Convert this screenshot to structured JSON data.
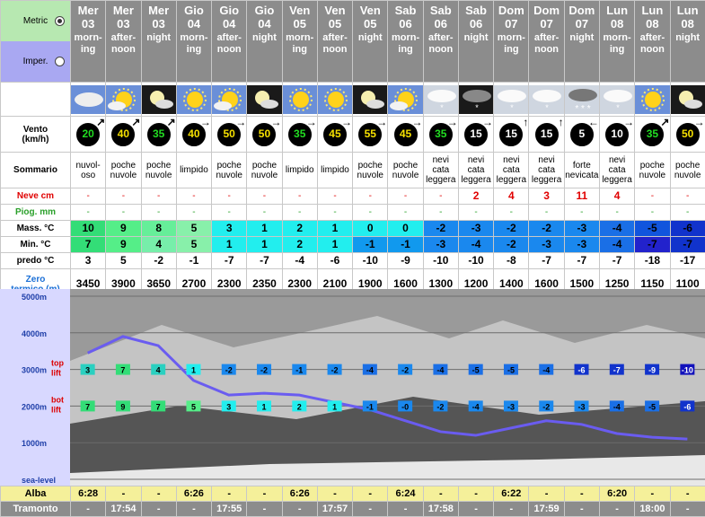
{
  "units": {
    "metric_label": "Metric",
    "imperial_label": "Imper."
  },
  "columns": [
    {
      "day": "Mer",
      "date": "03",
      "period": "morn-\ning",
      "wind_dir": "↗",
      "wind": "20",
      "wind_color": "#22dd22",
      "summary": "nuvol-\noso",
      "snow": "-",
      "rain": "-",
      "max": "10",
      "max_color": "#33dd77",
      "min": "7",
      "min_color": "#33dd77",
      "freeze": "3",
      "zero": "3450",
      "icon": "partly-cloudy"
    },
    {
      "day": "Mer",
      "date": "03",
      "period": "after-\nnoon",
      "wind_dir": "↗",
      "wind": "40",
      "wind_color": "#f5e000",
      "summary": "poche\nnuvole",
      "snow": "-",
      "rain": "-",
      "max": "9",
      "max_color": "#55ee88",
      "min": "9",
      "min_color": "#55ee88",
      "freeze": "5",
      "zero": "3900",
      "icon": "sun-cloud"
    },
    {
      "day": "Mer",
      "date": "03",
      "period": "night",
      "wind_dir": "↗",
      "wind": "35",
      "wind_color": "#22dd22",
      "summary": "poche\nnuvole",
      "snow": "-",
      "rain": "-",
      "max": "8",
      "max_color": "#66ee99",
      "min": "4",
      "min_color": "#77eeaa",
      "freeze": "-2",
      "zero": "3650",
      "icon": "moon-cloud"
    },
    {
      "day": "Gio",
      "date": "04",
      "period": "morn-\ning",
      "wind_dir": "→",
      "wind": "40",
      "wind_color": "#f5e000",
      "summary": "limpido",
      "snow": "-",
      "rain": "-",
      "max": "5",
      "max_color": "#88f0aa",
      "min": "5",
      "min_color": "#88f0aa",
      "freeze": "-1",
      "zero": "2700",
      "icon": "sun"
    },
    {
      "day": "Gio",
      "date": "04",
      "period": "after-\nnoon",
      "wind_dir": "→",
      "wind": "50",
      "wind_color": "#f5e000",
      "summary": "poche\nnuvole",
      "snow": "-",
      "rain": "-",
      "max": "3",
      "max_color": "#22eeee",
      "min": "1",
      "min_color": "#22eeee",
      "freeze": "-7",
      "zero": "2300",
      "icon": "sun-cloud"
    },
    {
      "day": "Gio",
      "date": "04",
      "period": "night",
      "wind_dir": "→",
      "wind": "50",
      "wind_color": "#f5e000",
      "summary": "poche\nnuvole",
      "snow": "-",
      "rain": "-",
      "max": "1",
      "max_color": "#22eeee",
      "min": "1",
      "min_color": "#22eeee",
      "freeze": "-7",
      "zero": "2350",
      "icon": "moon-cloud"
    },
    {
      "day": "Ven",
      "date": "05",
      "period": "morn-\ning",
      "wind_dir": "→",
      "wind": "35",
      "wind_color": "#22dd22",
      "summary": "limpido",
      "snow": "-",
      "rain": "-",
      "max": "2",
      "max_color": "#22eeee",
      "min": "2",
      "min_color": "#22eeee",
      "freeze": "-4",
      "zero": "2300",
      "icon": "sun"
    },
    {
      "day": "Ven",
      "date": "05",
      "period": "after-\nnoon",
      "wind_dir": "→",
      "wind": "45",
      "wind_color": "#f5e000",
      "summary": "limpido",
      "snow": "-",
      "rain": "-",
      "max": "1",
      "max_color": "#22eeee",
      "min": "1",
      "min_color": "#22eeee",
      "freeze": "-6",
      "zero": "2100",
      "icon": "sun"
    },
    {
      "day": "Ven",
      "date": "05",
      "period": "night",
      "wind_dir": "→",
      "wind": "55",
      "wind_color": "#f5e000",
      "summary": "poche\nnuvole",
      "snow": "-",
      "rain": "-",
      "max": "0",
      "max_color": "#22eeee",
      "min": "-1",
      "min_color": "#1199ee",
      "freeze": "-10",
      "zero": "1900",
      "icon": "moon-cloud"
    },
    {
      "day": "Sab",
      "date": "06",
      "period": "morn-\ning",
      "wind_dir": "→",
      "wind": "45",
      "wind_color": "#f5e000",
      "summary": "poche\nnuvole",
      "snow": "-",
      "rain": "-",
      "max": "0",
      "max_color": "#22eeee",
      "min": "-1",
      "min_color": "#1199ee",
      "freeze": "-9",
      "zero": "1600",
      "icon": "sun-cloud"
    },
    {
      "day": "Sab",
      "date": "06",
      "period": "after-\nnoon",
      "wind_dir": "→",
      "wind": "35",
      "wind_color": "#22dd22",
      "summary": "nevi\ncata\nleggera",
      "snow": "-",
      "rain": "-",
      "max": "-2",
      "max_color": "#1a88ee",
      "min": "-3",
      "min_color": "#1a88ee",
      "freeze": "-10",
      "zero": "1300",
      "icon": "snow-cloud"
    },
    {
      "day": "Sab",
      "date": "06",
      "period": "night",
      "wind_dir": "→",
      "wind": "15",
      "wind_color": "#ffffff",
      "summary": "nevi\ncata\nleggera",
      "snow": "2",
      "rain": "-",
      "max": "-3",
      "max_color": "#1a88ee",
      "min": "-4",
      "min_color": "#1a88ee",
      "freeze": "-10",
      "zero": "1200",
      "icon": "snow-night"
    },
    {
      "day": "Dom",
      "date": "07",
      "period": "morn-\ning",
      "wind_dir": "↑",
      "wind": "15",
      "wind_color": "#ffffff",
      "summary": "nevi\ncata\nleggera",
      "snow": "4",
      "rain": "-",
      "max": "-2",
      "max_color": "#1a88ee",
      "min": "-2",
      "min_color": "#1a88ee",
      "freeze": "-8",
      "zero": "1400",
      "icon": "snow-cloud"
    },
    {
      "day": "Dom",
      "date": "07",
      "period": "after-\nnoon",
      "wind_dir": "↑",
      "wind": "15",
      "wind_color": "#ffffff",
      "summary": "nevi\ncata\nleggera",
      "snow": "3",
      "rain": "-",
      "max": "-2",
      "max_color": "#1a88ee",
      "min": "-3",
      "min_color": "#1a88ee",
      "freeze": "-7",
      "zero": "1600",
      "icon": "snow-cloud"
    },
    {
      "day": "Dom",
      "date": "07",
      "period": "night",
      "wind_dir": "←",
      "wind": "5",
      "wind_color": "#ffffff",
      "summary": "forte\nnevicata",
      "snow": "11",
      "rain": "-",
      "max": "-3",
      "max_color": "#1a88ee",
      "min": "-3",
      "min_color": "#1a88ee",
      "freeze": "-7",
      "zero": "1500",
      "icon": "heavy-snow"
    },
    {
      "day": "Lun",
      "date": "08",
      "period": "morn-\ning",
      "wind_dir": "→",
      "wind": "10",
      "wind_color": "#ffffff",
      "summary": "nevi\ncata\nleggera",
      "snow": "4",
      "rain": "-",
      "max": "-4",
      "max_color": "#1a6fe6",
      "min": "-4",
      "min_color": "#1a6fe6",
      "freeze": "-7",
      "zero": "1250",
      "icon": "snow-cloud"
    },
    {
      "day": "Lun",
      "date": "08",
      "period": "after-\nnoon",
      "wind_dir": "↗",
      "wind": "35",
      "wind_color": "#22dd22",
      "summary": "poche\nnuvole",
      "snow": "-",
      "rain": "-",
      "max": "-5",
      "max_color": "#1155dd",
      "min": "-7",
      "min_color": "#2222cc",
      "freeze": "-18",
      "zero": "1150",
      "icon": "sun"
    },
    {
      "day": "Lun",
      "date": "08",
      "period": "night",
      "wind_dir": "→",
      "wind": "50",
      "wind_color": "#f5e000",
      "summary": "poche\nnuvole",
      "snow": "-",
      "rain": "-",
      "max": "-6",
      "max_color": "#1133cc",
      "min": "-7",
      "min_color": "#1133cc",
      "freeze": "-17",
      "zero": "1100",
      "icon": "moon-cloud"
    }
  ],
  "labels": {
    "vento": "Vento\n(km/h)",
    "sommario": "Sommario",
    "neve": "Neve cm",
    "piog": "Piog. mm",
    "mass": "Mass. °C",
    "min": "Min. °C",
    "freeze": "predo °C",
    "zero": "Zero\ntermico (m)"
  },
  "chart_data": {
    "type": "line",
    "yaxis_labels": [
      "5000m",
      "4000m",
      "3000m",
      "2000m",
      "1000m",
      "sea-level"
    ],
    "top_label": "top\nlift",
    "bot_label": "bot\nlift",
    "freezing_level": [
      3450,
      3900,
      3650,
      2700,
      2300,
      2350,
      2300,
      2100,
      1900,
      1600,
      1300,
      1200,
      1400,
      1600,
      1500,
      1250,
      1150,
      1100
    ],
    "top_lift_temps": [
      "3",
      "7",
      "4",
      "1",
      "-2",
      "-2",
      "-1",
      "-2",
      "-4",
      "-2",
      "-4",
      "-5",
      "-5",
      "-4",
      "-6",
      "-7",
      "-9",
      "-10"
    ],
    "bot_lift_temps": [
      "7",
      "9",
      "7",
      "5",
      "3",
      "1",
      "2",
      "1",
      "-1",
      "-0",
      "-2",
      "-4",
      "-3",
      "-2",
      "-3",
      "-4",
      "-5",
      "-6"
    ],
    "top_colors": [
      "#2ad0c0",
      "#33dd77",
      "#2ad0c0",
      "#22eeee",
      "#1a88ee",
      "#1a88ee",
      "#1a88ee",
      "#1a88ee",
      "#1a6fe6",
      "#1a88ee",
      "#1a6fe6",
      "#1a6fe6",
      "#1a6fe6",
      "#1a6fe6",
      "#1133cc",
      "#1133cc",
      "#1133cc",
      "#1111bb"
    ],
    "bot_colors": [
      "#33dd77",
      "#33dd77",
      "#33dd77",
      "#55ee88",
      "#22eeee",
      "#22eeee",
      "#22eeee",
      "#22eeee",
      "#1a88ee",
      "#1a88ee",
      "#1a88ee",
      "#1a88ee",
      "#1a88ee",
      "#1a88ee",
      "#1a88ee",
      "#1a6fe6",
      "#1a6fe6",
      "#1133cc"
    ]
  },
  "sun": {
    "alba_label": "Alba",
    "tramonto_label": "Tramonto",
    "alba": [
      "6:28",
      "-",
      "-",
      "6:26",
      "-",
      "-",
      "6:26",
      "-",
      "-",
      "6:24",
      "-",
      "-",
      "6:22",
      "-",
      "-",
      "6:20",
      "-",
      "-"
    ],
    "tramonto": [
      "-",
      "17:54",
      "-",
      "-",
      "17:55",
      "-",
      "-",
      "17:57",
      "-",
      "-",
      "17:58",
      "-",
      "-",
      "17:59",
      "-",
      "-",
      "18:00",
      "-"
    ]
  }
}
